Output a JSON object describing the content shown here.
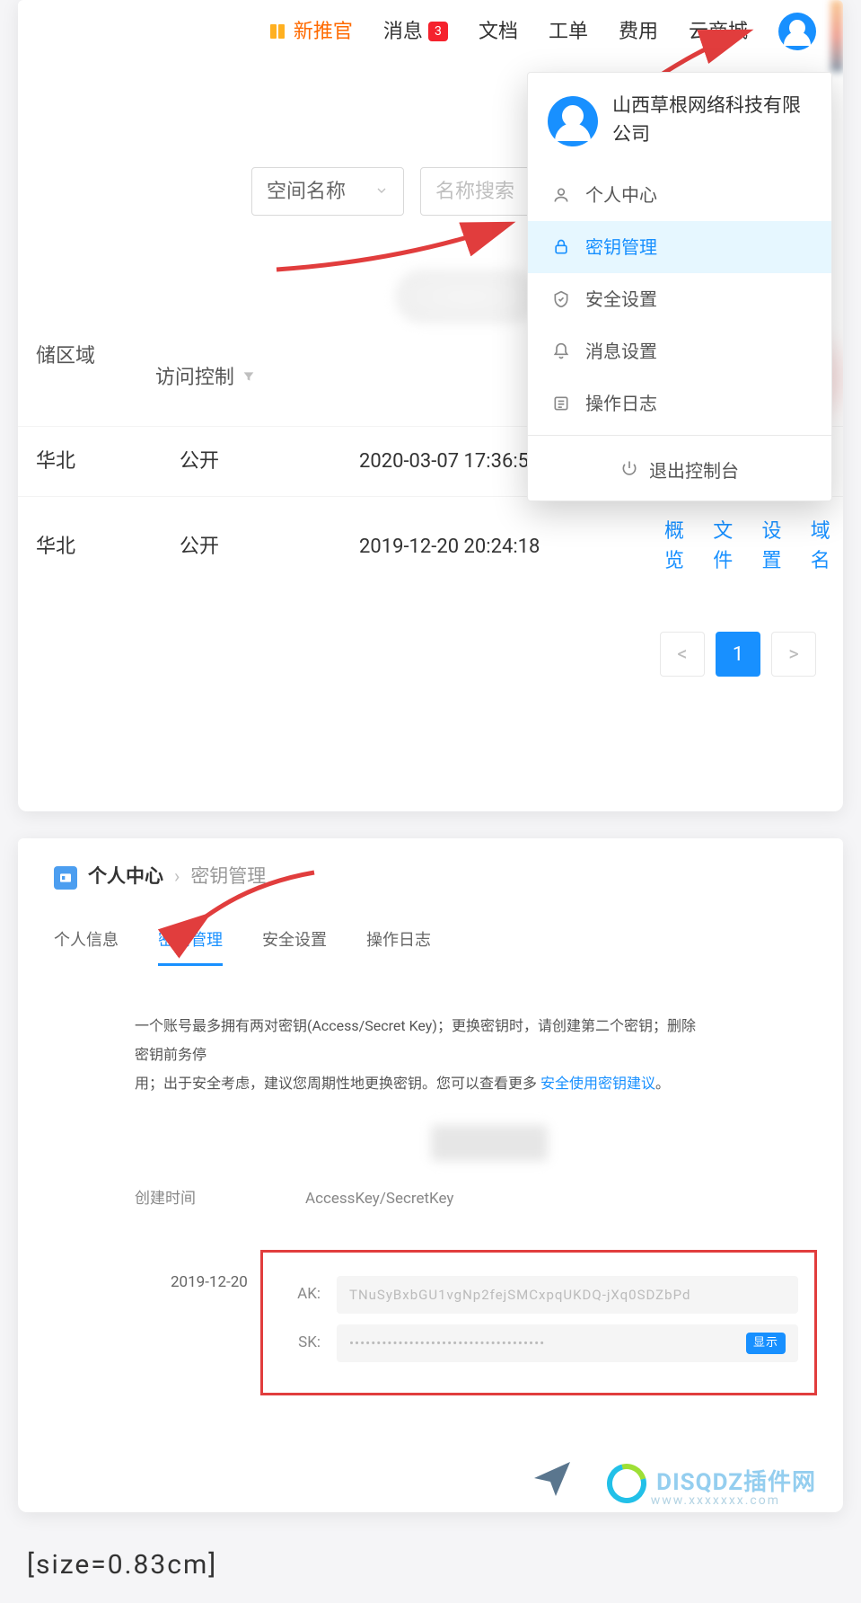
{
  "topnav": {
    "recommend": "新推官",
    "messages": "消息",
    "messages_badge": "3",
    "docs": "文档",
    "tickets": "工单",
    "billing": "费用",
    "mall": "云商城"
  },
  "dropdown": {
    "company": "山西草根网络科技有限公司",
    "items": {
      "personal": "个人中心",
      "keys": "密钥管理",
      "security": "安全设置",
      "msgset": "消息设置",
      "oplog": "操作日志"
    },
    "logout": "退出控制台"
  },
  "search": {
    "select_label": "空间名称",
    "placeholder": "名称搜索"
  },
  "table": {
    "headers": {
      "region": "储区域",
      "access": "访问控制"
    },
    "rows": [
      {
        "region": "华北",
        "access": "公开",
        "time": "2020-03-07 17:36:5"
      },
      {
        "region": "华北",
        "access": "公开",
        "time": "2019-12-20 20:24:18"
      }
    ],
    "links": {
      "overview": "概览",
      "files": "文件",
      "settings": "设置",
      "domain": "域名"
    }
  },
  "pagination": {
    "prev": "<",
    "page1": "1",
    "next": ">"
  },
  "breadcrumb": {
    "root": "个人中心",
    "current": "密钥管理"
  },
  "tabs": {
    "info": "个人信息",
    "keys": "密钥管理",
    "security": "安全设置",
    "oplog": "操作日志"
  },
  "info": {
    "line1_a": "一个账号最多拥有两对密钥(Access/Secret Key)；更换密钥时，请创建第二个密钥；删除密钥前务停",
    "line1_b": "用；出于安全考虑，建议您周期性地更换密钥。您可以查看更多 ",
    "link": "安全使用密钥建议",
    "punct": "。"
  },
  "key_table": {
    "headers": {
      "created": "创建时间",
      "aksk": "AccessKey/SecretKey"
    },
    "date": "2019-12-20",
    "ak_label": "AK:",
    "sk_label": "SK:",
    "ak_value": "TNuSyBxbGU1vgNp2fejSMCxpqUKDQ-jXq0SDZbPd",
    "sk_value": "••••••••••••••••••••••••••••••••••••",
    "show": "显示"
  },
  "watermark": {
    "brand": "DISQDZ插件网",
    "sub": "www.xxxxxxx.com"
  },
  "caption": "[size=0.83cm]"
}
